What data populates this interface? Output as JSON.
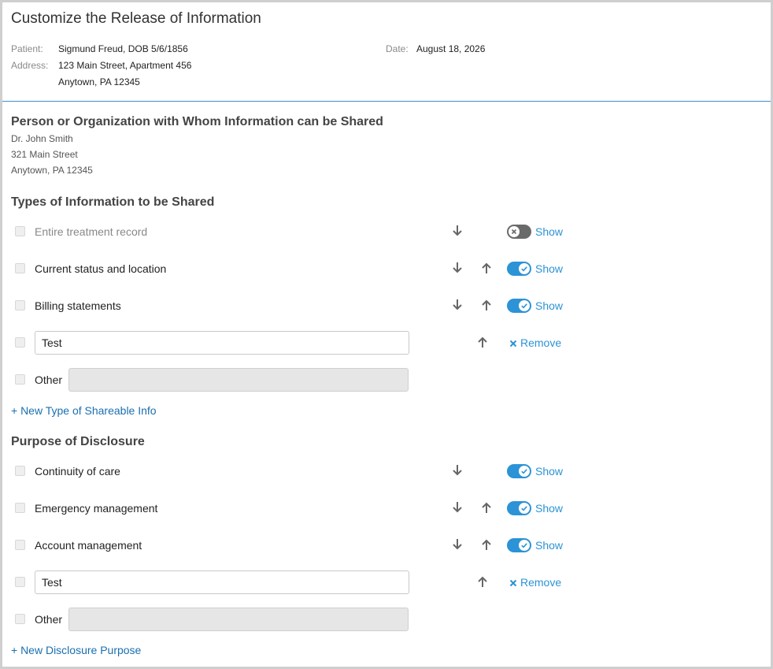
{
  "header": {
    "title": "Customize the Release of Information",
    "patient_label": "Patient:",
    "patient_value": "Sigmund Freud, DOB 5/6/1856",
    "address_label": "Address:",
    "address_line1": "123 Main Street, Apartment 456",
    "address_line2": "Anytown, PA 12345",
    "date_label": "Date:",
    "date_value": "August 18, 2026"
  },
  "recipient": {
    "title": "Person or Organization with Whom Information can be Shared",
    "name": "Dr. John Smith",
    "street": "321 Main Street",
    "city": "Anytown, PA 12345"
  },
  "types": {
    "title": "Types of Information to be Shared",
    "items": [
      {
        "label": "Entire treatment record",
        "toggle_label": "Show",
        "toggle_on": false
      },
      {
        "label": "Current status and location",
        "toggle_label": "Show",
        "toggle_on": true
      },
      {
        "label": "Billing statements",
        "toggle_label": "Show",
        "toggle_on": true
      }
    ],
    "custom_value": "Test",
    "remove_label": "Remove",
    "other_label": "Other",
    "other_value": "",
    "add_label": "+ New Type of Shareable Info"
  },
  "purpose": {
    "title": "Purpose of Disclosure",
    "items": [
      {
        "label": "Continuity of care",
        "toggle_label": "Show",
        "toggle_on": true
      },
      {
        "label": "Emergency management",
        "toggle_label": "Show",
        "toggle_on": true
      },
      {
        "label": "Account management",
        "toggle_label": "Show",
        "toggle_on": true
      }
    ],
    "custom_value": "Test",
    "remove_label": "Remove",
    "other_label": "Other",
    "other_value": "",
    "add_label": "+ New Disclosure Purpose"
  },
  "colors": {
    "accent": "#2b93d6",
    "link": "#1a6fb0",
    "toggle_off": "#6a6a6a",
    "divider": "#3a8fd0"
  }
}
